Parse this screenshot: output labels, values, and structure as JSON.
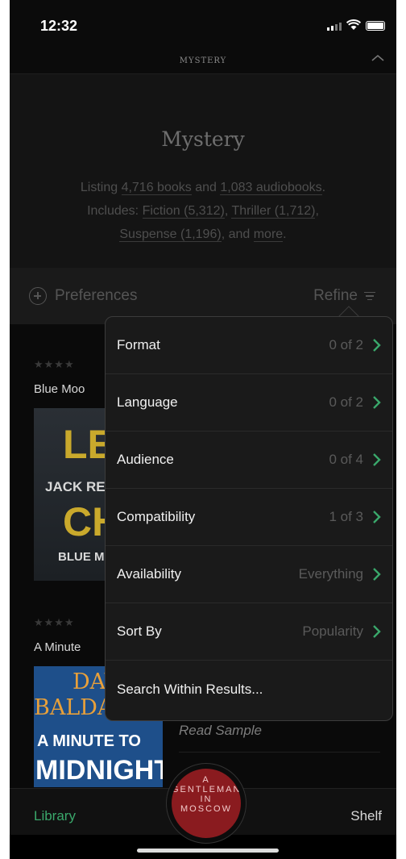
{
  "status": {
    "time": "12:32"
  },
  "nav": {
    "title": "MYSTERY"
  },
  "header": {
    "title": "Mystery",
    "line1_prefix": "Listing ",
    "books": "4,716 books",
    "line1_mid": " and ",
    "audiobooks": "1,083 audiobooks",
    "line1_suffix": ".",
    "line2_prefix": "Includes: ",
    "fiction": "Fiction (5,312)",
    "sep1": ", ",
    "thriller": "Thriller (1,712)",
    "sep2": ",",
    "suspense": "Suspense (1,196)",
    "line3_mid": ", and ",
    "more": "more",
    "line3_suffix": "."
  },
  "toolbar": {
    "preferences": "Preferences",
    "refine": "Refine"
  },
  "books": [
    {
      "stars": "★★★★",
      "title": "Blue Moo"
    },
    {
      "stars": "★★★★",
      "title": "A Minute"
    }
  ],
  "covers": {
    "c1_top": "LE",
    "c1_mid": "JACK RE",
    "c1_big2": "CHI",
    "c1_bottom": "BLUE M",
    "c2_a": "DAV",
    "c2_b": "BALDA",
    "c2_c": "A MINUTE TO",
    "c2_d": "MIDNIGHT"
  },
  "read_sample": "Read Sample",
  "dropdown": {
    "items": [
      {
        "label": "Format",
        "value": "0 of 2"
      },
      {
        "label": "Language",
        "value": "0 of 2"
      },
      {
        "label": "Audience",
        "value": "0 of 4"
      },
      {
        "label": "Compatibility",
        "value": "1 of 3"
      },
      {
        "label": "Availability",
        "value": "Everything"
      },
      {
        "label": "Sort By",
        "value": "Popularity"
      },
      {
        "label": "Search Within Results...",
        "value": ""
      }
    ]
  },
  "tabs": {
    "library": "Library",
    "shelf": "Shelf"
  },
  "now_playing": {
    "l1": "A",
    "l2": "GENTLEMAN",
    "l3": "IN",
    "l4": "MOSCOW"
  },
  "colors": {
    "accent": "#3aa86b",
    "background": "#000000",
    "chevron": "#3aa86b"
  }
}
